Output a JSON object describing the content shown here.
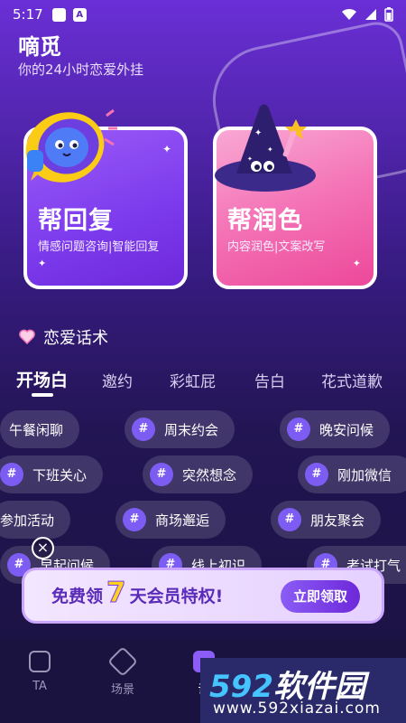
{
  "status_bar": {
    "time": "5:17",
    "badge": "A"
  },
  "header": {
    "title": "嘀觅",
    "subtitle": "你的24小时恋爱外挂"
  },
  "cards": [
    {
      "title": "帮回复",
      "desc": "情感问题咨询|智能回复",
      "icon": "megaphone-icon"
    },
    {
      "title": "帮润色",
      "desc": "内容润色|文案改写",
      "icon": "wizard-hat-icon"
    }
  ],
  "section": {
    "title": "恋爱话术",
    "icon": "heart-icon"
  },
  "tabs": [
    "开场白",
    "邀约",
    "彩虹屁",
    "告白",
    "花式道歉"
  ],
  "chips": [
    {
      "label": "午餐闲聊"
    },
    {
      "label": "周末约会"
    },
    {
      "label": "晚安问候"
    },
    {
      "label": "下班关心"
    },
    {
      "label": "突然想念"
    },
    {
      "label": "刚加微信"
    },
    {
      "label": "参加活动"
    },
    {
      "label": "商场邂逅"
    },
    {
      "label": "朋友聚会"
    },
    {
      "label": "早起问候"
    },
    {
      "label": "线上初识"
    },
    {
      "label": "考试打气"
    }
  ],
  "chip_icon": "#",
  "promo": {
    "prefix": "免费领",
    "number": "7",
    "suffix": "天会员特权!",
    "button": "立即领取"
  },
  "tabbar": [
    {
      "label": "TA",
      "icon": "ta-icon"
    },
    {
      "label": "场景",
      "icon": "scene-icon"
    },
    {
      "label": "话",
      "icon": "chat-icon"
    }
  ],
  "watermark": {
    "brand_num": "592",
    "brand_cn": "软件园",
    "url": "www.592xiazai.com"
  },
  "colors": {
    "bg_top": "#6a2fd6",
    "card_left": "#7c3aed",
    "card_right": "#f472b6",
    "accent": "#ffd21f"
  }
}
